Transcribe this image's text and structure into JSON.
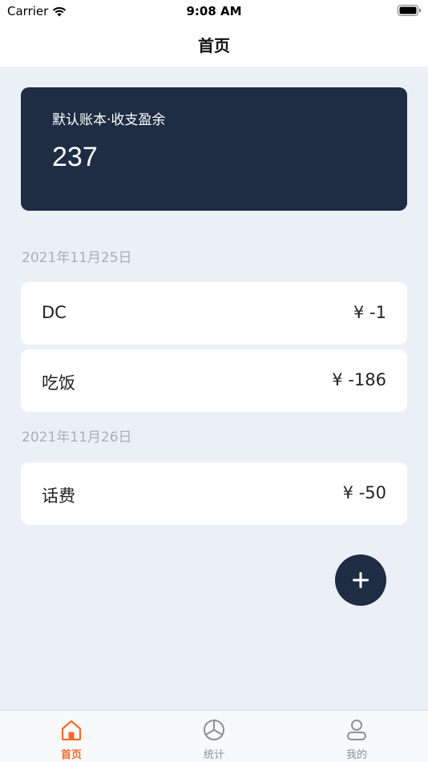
{
  "status_bar": {
    "carrier": "Carrier",
    "time": "9:08 AM"
  },
  "nav": {
    "title": "首页"
  },
  "summary": {
    "label": "默认账本·收支盈余",
    "value": "237"
  },
  "groups": [
    {
      "date": "2021年11月25日",
      "records": [
        {
          "name": "DC",
          "amount": "¥ -1"
        },
        {
          "name": "吃饭",
          "amount": "¥ -186"
        }
      ]
    },
    {
      "date": "2021年11月26日",
      "records": [
        {
          "name": "话费",
          "amount": "¥ -50"
        }
      ]
    }
  ],
  "fab": {
    "icon": "plus-icon"
  },
  "tabs": [
    {
      "label": "首页",
      "icon": "home-icon",
      "active": true
    },
    {
      "label": "统计",
      "icon": "pie-chart-icon",
      "active": false
    },
    {
      "label": "我的",
      "icon": "user-icon",
      "active": false
    }
  ],
  "colors": {
    "accent": "#f36b2c",
    "card_bg": "#1e2c44",
    "page_bg": "#ebf0f6"
  }
}
